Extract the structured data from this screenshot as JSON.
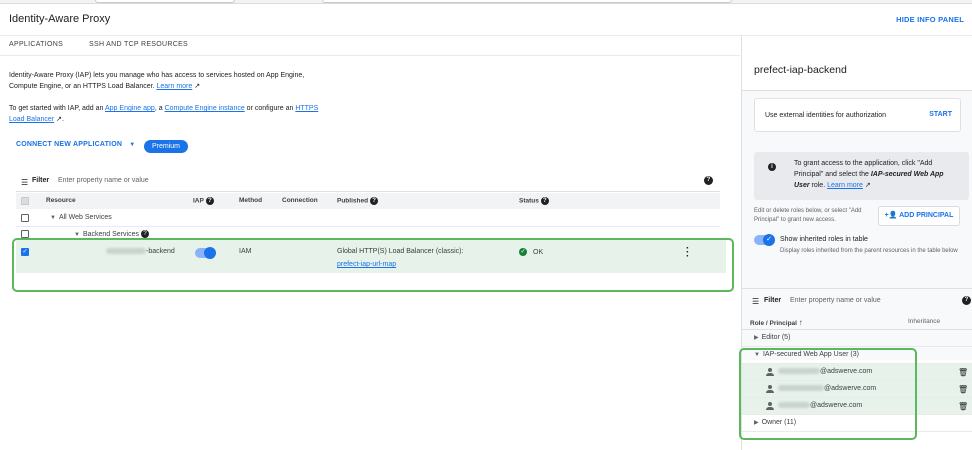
{
  "header": {
    "title": "Identity-Aware Proxy",
    "hide_info_panel": "HIDE INFO PANEL"
  },
  "tabs": [
    {
      "label": "APPLICATIONS"
    },
    {
      "label": "SSH AND TCP RESOURCES"
    }
  ],
  "intro": {
    "line1_pre": "Identity-Aware Proxy (IAP) lets you manage who has access to services hosted on App Engine, Compute Engine, or an HTTPS Load Balancer. ",
    "learn_more": "Learn more",
    "line2_pre": "To get started with IAP, add an ",
    "app_engine_link": "App Engine app",
    "line2_mid": ", a ",
    "compute_link": "Compute Engine instance",
    "line2_post": " or configure an ",
    "lb_link": "HTTPS Load Balancer",
    "line2_end": "."
  },
  "connect_button": "CONNECT NEW APPLICATION",
  "premium_badge": "Premium",
  "filter": {
    "label": "Filter",
    "placeholder": "Enter property name or value"
  },
  "table": {
    "columns": [
      "Resource",
      "IAP",
      "Method",
      "Connection",
      "Published",
      "Status"
    ],
    "group_all": "All Web Services",
    "group_backend": "Backend Services",
    "row": {
      "resource_suffix": "-backend",
      "method": "IAM",
      "published_line1": "Global HTTP(S) Load Balancer (classic):",
      "published_link": "prefect-iap-url-map",
      "status": "OK",
      "iap_enabled": true,
      "selected": true
    }
  },
  "info_panel": {
    "title": "prefect-iap-backend",
    "external_text": "Use external identities for authorization",
    "start_button": "START",
    "info_pre": "To grant access to the application, click \"Add Principal\" and select the ",
    "info_role": "IAP-secured Web App User",
    "info_post": " role. ",
    "info_learn": "Learn more",
    "edit_note": "Edit or delete roles below, or select \"Add Principal\" to grant new access.",
    "add_principal": "ADD PRINCIPAL",
    "show_inherited": "Show inherited roles in table",
    "show_inherited_sub": "Display roles inherited from the parent resources in the table below",
    "filter_label": "Filter",
    "filter_placeholder": "Enter property name or value",
    "col_role": "Role / Principal",
    "col_inheritance": "Inheritance",
    "roles": [
      {
        "label": "Editor (5)",
        "expanded": false
      },
      {
        "label": "IAP-secured Web App User (3)",
        "expanded": true
      },
      {
        "label": "Owner (11)",
        "expanded": false
      }
    ],
    "users": [
      {
        "suffix": "@adswerve.com"
      },
      {
        "suffix": "@adswerve.com"
      },
      {
        "suffix": "@adswerve.com"
      }
    ]
  },
  "colors": {
    "accent": "#1a73e8",
    "highlight_outline": "#5cb85c",
    "selected_row": "#e6f2ea",
    "ok_green": "#188038"
  }
}
